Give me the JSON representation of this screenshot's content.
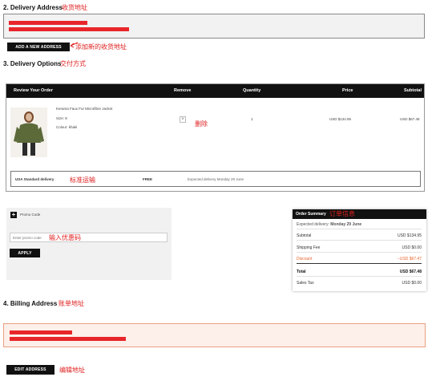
{
  "delivery_address": {
    "title": "2. Delivery Address",
    "note": "收货地址",
    "add_button": "ADD A NEW ADDRESS",
    "add_note": "添加新的收货地址"
  },
  "delivery_options": {
    "title": "3. Delivery Options",
    "note": "交付方式"
  },
  "review": {
    "header": {
      "title": "Review Your Order",
      "remove": "Remove",
      "quantity": "Quantity",
      "price": "Price",
      "subtotal": "Subtotal"
    },
    "item": {
      "name": "Kerama Faux Fur Microfibre Jacket",
      "size": "Size: 8",
      "colour": "Colour: khaki",
      "remove_glyph": "×",
      "remove_note": "删除",
      "quantity": "1",
      "price": "USD $134.95",
      "subtotal": "USD $67.48"
    },
    "shipping": {
      "method": "USA Standard delivery",
      "note": "标准运输",
      "cost": "FREE",
      "expected": "Expected delivery Monday 29 June"
    }
  },
  "promo": {
    "toggle_glyph": "+",
    "label": "Promo Code",
    "placeholder": "Enter promo code",
    "note": "输入优惠码",
    "apply": "APPLY"
  },
  "summary": {
    "title": "Order Summary",
    "note": "订单信息",
    "expected_label": "Expected delivery:",
    "expected_value": "Monday 29 June",
    "rows": [
      {
        "label": "Subtotal",
        "value": "USD $134.95"
      },
      {
        "label": "Shipping Fee",
        "value": "USD $0.00"
      },
      {
        "label": "Discount",
        "value": "−USD $67.47"
      },
      {
        "label": "Total",
        "value": "USD $67.48"
      },
      {
        "label": "Sales Tax",
        "value": "USD $0.00"
      }
    ],
    "discount_color": "#e8622a"
  },
  "billing": {
    "title": "4. Billing Address",
    "note": "账单地址",
    "edit_button": "EDIT ADDRESS",
    "edit_note": "编辑地址"
  }
}
